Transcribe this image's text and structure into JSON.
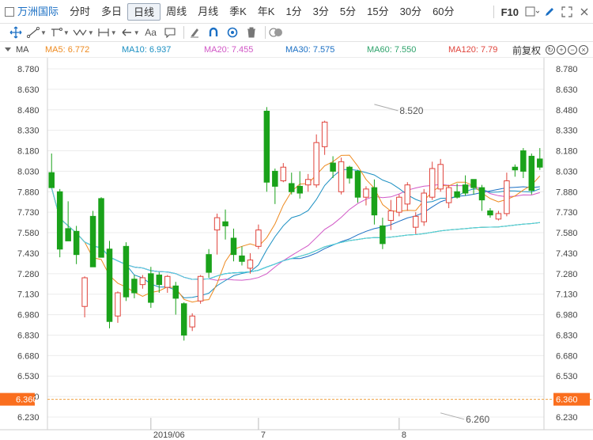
{
  "topbar": {
    "stock_name": "万洲国际",
    "periods": [
      "分时",
      "多日",
      "日线",
      "周线",
      "月线",
      "季K",
      "年K",
      "1分",
      "3分",
      "5分",
      "15分",
      "30分",
      "60分"
    ],
    "active_period": "日线",
    "f10_label": "F10"
  },
  "toolbar": {
    "text_tool_label": "Aa"
  },
  "ma_legend": {
    "label": "MA",
    "items": [
      {
        "text": "MA5: 6.772",
        "color": "#ee8a1f"
      },
      {
        "text": "MA10: 6.937",
        "color": "#1a8fc2"
      },
      {
        "text": "MA20: 7.455",
        "color": "#d157c6"
      },
      {
        "text": "MA30: 7.575",
        "color": "#1a6fc4"
      },
      {
        "text": "MA60: 7.550",
        "color": "#2ea36b"
      },
      {
        "text": "MA120: 7.79",
        "color": "#e0443c"
      }
    ],
    "adjust_label": "前复权"
  },
  "colors": {
    "up": "#e0443c",
    "down": "#1aa21a",
    "ma5": "#ee8a1f",
    "ma10": "#1a8fc2",
    "ma20": "#d157c6",
    "ma30": "#1a6fc4",
    "ma60": "#2ea36b",
    "ma120": "#e0443c",
    "ma250": "#4fd8e6",
    "price_line": "#f0a040",
    "label_bg": "#fa6e1e",
    "grid": "#ececec"
  },
  "chart_data": {
    "type": "candlestick",
    "ylim": [
      6.23,
      8.78
    ],
    "y_ticks": [
      "8.780",
      "8.630",
      "8.480",
      "8.330",
      "8.180",
      "8.030",
      "7.880",
      "7.730",
      "7.580",
      "7.430",
      "7.280",
      "7.130",
      "6.980",
      "6.830",
      "6.680",
      "6.530",
      "6.380",
      "6.230"
    ],
    "x_labels": [
      {
        "index": 12,
        "label": "2019/06"
      },
      {
        "index": 25,
        "label": "7"
      },
      {
        "index": 42,
        "label": "8"
      }
    ],
    "current_price": "6.360",
    "annotations": [
      {
        "index": 39,
        "value": 8.52,
        "text": "8.520"
      },
      {
        "index": 47,
        "value": 6.26,
        "text": "6.260"
      }
    ],
    "candles": [
      [
        8.02,
        7.91,
        8.16,
        7.91
      ],
      [
        7.88,
        7.46,
        7.9,
        7.4
      ],
      [
        7.61,
        7.52,
        7.81,
        7.52
      ],
      [
        7.59,
        7.42,
        7.63,
        7.35
      ],
      [
        7.04,
        7.25,
        7.26,
        6.96
      ],
      [
        7.7,
        7.33,
        7.74,
        7.33
      ],
      [
        7.83,
        7.4,
        7.84,
        7.4
      ],
      [
        7.46,
        6.93,
        7.52,
        6.88
      ],
      [
        6.97,
        7.14,
        7.15,
        6.92
      ],
      [
        7.48,
        7.11,
        7.51,
        7.08
      ],
      [
        7.24,
        7.14,
        7.27,
        7.1
      ],
      [
        7.2,
        7.25,
        7.27,
        7.17
      ],
      [
        7.28,
        7.07,
        7.33,
        7.03
      ],
      [
        7.27,
        7.2,
        7.29,
        7.14
      ],
      [
        7.18,
        7.26,
        7.27,
        7.14
      ],
      [
        7.19,
        7.1,
        7.22,
        6.98
      ],
      [
        7.06,
        6.83,
        7.07,
        6.79
      ],
      [
        6.89,
        6.97,
        6.99,
        6.86
      ],
      [
        7.08,
        7.26,
        7.27,
        7.06
      ],
      [
        7.42,
        7.29,
        7.46,
        7.25
      ],
      [
        7.6,
        7.69,
        7.72,
        7.42
      ],
      [
        7.66,
        7.63,
        7.75,
        7.53
      ],
      [
        7.54,
        7.42,
        7.61,
        7.37
      ],
      [
        7.41,
        7.37,
        7.48,
        7.34
      ],
      [
        7.32,
        7.38,
        7.43,
        7.28
      ],
      [
        7.48,
        7.6,
        7.64,
        7.46
      ],
      [
        8.47,
        7.95,
        8.5,
        7.88
      ],
      [
        8.03,
        7.92,
        8.05,
        7.79
      ],
      [
        7.96,
        8.06,
        8.09,
        7.95
      ],
      [
        7.94,
        7.88,
        8.02,
        7.86
      ],
      [
        7.92,
        7.87,
        8.03,
        7.83
      ],
      [
        7.93,
        7.97,
        8.01,
        7.88
      ],
      [
        7.93,
        8.24,
        8.3,
        7.91
      ],
      [
        8.21,
        8.39,
        8.4,
        8.15
      ],
      [
        8.09,
        8.03,
        8.14,
        7.98
      ],
      [
        7.88,
        8.1,
        8.13,
        7.86
      ],
      [
        8.06,
        7.98,
        8.07,
        7.94
      ],
      [
        8.03,
        7.84,
        8.04,
        7.8
      ],
      [
        7.84,
        7.9,
        7.92,
        7.78
      ],
      [
        7.91,
        7.71,
        7.97,
        7.64
      ],
      [
        7.63,
        7.5,
        7.69,
        7.46
      ],
      [
        7.67,
        7.74,
        7.82,
        7.6
      ],
      [
        7.73,
        7.84,
        7.86,
        7.7
      ],
      [
        7.79,
        7.93,
        7.95,
        7.74
      ],
      [
        7.62,
        7.7,
        7.73,
        7.57
      ],
      [
        7.66,
        7.87,
        7.9,
        7.63
      ],
      [
        7.84,
        8.05,
        8.1,
        7.82
      ],
      [
        7.9,
        8.08,
        8.12,
        7.88
      ],
      [
        7.8,
        7.91,
        7.93,
        7.76
      ],
      [
        7.88,
        7.84,
        7.94,
        7.83
      ],
      [
        7.93,
        7.87,
        8.0,
        7.85
      ],
      [
        7.97,
        7.91,
        7.97,
        7.86
      ],
      [
        7.91,
        7.82,
        7.93,
        7.74
      ],
      [
        7.74,
        7.71,
        7.76,
        7.69
      ],
      [
        7.68,
        7.72,
        7.74,
        7.67
      ],
      [
        7.72,
        7.96,
        8.02,
        7.7
      ],
      [
        8.06,
        8.04,
        8.08,
        7.99
      ],
      [
        8.18,
        8.03,
        8.2,
        7.98
      ],
      [
        8.14,
        7.89,
        8.16,
        7.86
      ],
      [
        8.12,
        8.06,
        8.2,
        8.04
      ]
    ]
  }
}
